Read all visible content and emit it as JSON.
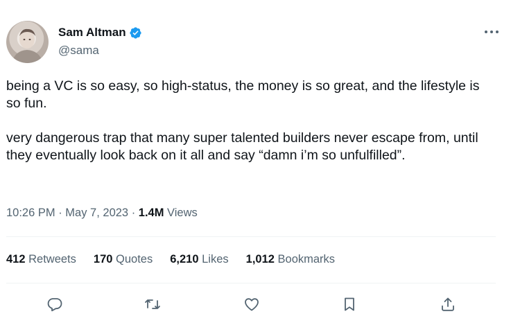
{
  "author": {
    "display_name": "Sam Altman",
    "handle": "@sama",
    "verified": true,
    "avatar_icon": "avatar-photo"
  },
  "tweet": {
    "paragraphs": [
      "being a VC is so easy, so high-status, the money is so great, and the lifestyle is so fun.",
      "very dangerous trap that many super talented builders never escape from, until they eventually look back on it all and say “damn i’m so unfulfilled”."
    ]
  },
  "meta": {
    "time": "10:26 PM",
    "separator": " · ",
    "date": "May 7, 2023",
    "views_count": "1.4M",
    "views_label": " Views"
  },
  "stats": [
    {
      "count": "412",
      "label": " Retweets"
    },
    {
      "count": "170",
      "label": " Quotes"
    },
    {
      "count": "6,210",
      "label": " Likes"
    },
    {
      "count": "1,012",
      "label": " Bookmarks"
    }
  ],
  "actions": [
    "reply-icon",
    "retweet-icon",
    "like-icon",
    "bookmark-icon",
    "share-icon"
  ],
  "colors": {
    "text": "#0f1419",
    "secondary": "#536471",
    "verified": "#1d9bf0",
    "divider": "#eff3f4"
  }
}
